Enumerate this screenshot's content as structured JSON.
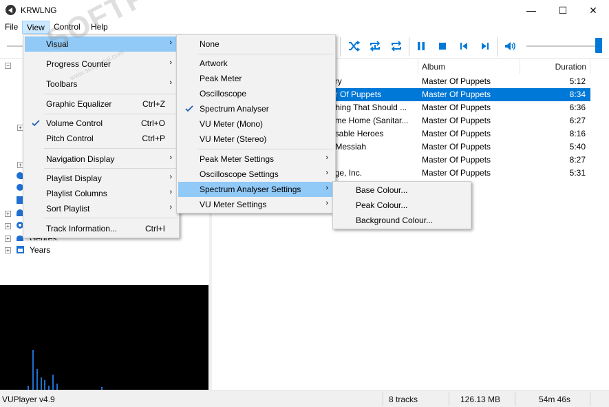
{
  "window": {
    "title": "KRWLNG",
    "minimize_glyph": "—",
    "maximize_glyph": "☐",
    "close_glyph": "✕"
  },
  "menubar": {
    "file": "File",
    "view": "View",
    "control": "Control",
    "help": "Help"
  },
  "tree": {
    "genres_partial": "Genres",
    "years": "Years"
  },
  "playlist": {
    "columns": {
      "album": "Album",
      "duration": "Duration"
    },
    "rows": [
      {
        "title": "ery",
        "album": "Master Of Puppets",
        "duration": "5:12",
        "selected": false
      },
      {
        "title": "er Of Puppets",
        "album": "Master Of Puppets",
        "duration": "8:34",
        "selected": true
      },
      {
        "title": "Thing That Should ...",
        "album": "Master Of Puppets",
        "duration": "6:36",
        "selected": false
      },
      {
        "title": "ome Home (Sanitar...",
        "album": "Master Of Puppets",
        "duration": "6:27",
        "selected": false
      },
      {
        "title": "osable Heroes",
        "album": "Master Of Puppets",
        "duration": "8:16",
        "selected": false
      },
      {
        "title": "r Messiah",
        "album": "Master Of Puppets",
        "duration": "5:40",
        "selected": false
      },
      {
        "title": "n",
        "album": "Master Of Puppets",
        "duration": "8:27",
        "selected": false
      },
      {
        "title": "age, Inc.",
        "album": "Master Of Puppets",
        "duration": "5:31",
        "selected": false
      }
    ]
  },
  "statusbar": {
    "version": "VUPlayer v4.9",
    "tracks": "8 tracks",
    "size": "126.13 MB",
    "length": "54m 46s"
  },
  "view_menu": {
    "items": [
      {
        "label": "Visual",
        "submenu": true
      },
      {
        "label": "Progress Counter",
        "submenu": true
      },
      {
        "label": "Toolbars",
        "submenu": true
      },
      {
        "label": "Graphic Equalizer",
        "shortcut": "Ctrl+Z"
      },
      {
        "label": "Volume Control",
        "shortcut": "Ctrl+O",
        "checked": true
      },
      {
        "label": "Pitch Control",
        "shortcut": "Ctrl+P"
      },
      {
        "label": "Navigation Display",
        "submenu": true
      },
      {
        "label": "Playlist Display",
        "submenu": true
      },
      {
        "label": "Playlist Columns",
        "submenu": true
      },
      {
        "label": "Sort Playlist",
        "submenu": true
      },
      {
        "label": "Track Information...",
        "shortcut": "Ctrl+I"
      }
    ]
  },
  "visual_menu": {
    "items": [
      {
        "label": "None"
      },
      {
        "label": "Artwork"
      },
      {
        "label": "Peak Meter"
      },
      {
        "label": "Oscilloscope"
      },
      {
        "label": "Spectrum Analyser",
        "checked": true
      },
      {
        "label": "VU Meter (Mono)"
      },
      {
        "label": "VU Meter (Stereo)"
      },
      {
        "label": "Peak Meter Settings",
        "submenu": true
      },
      {
        "label": "Oscilloscope Settings",
        "submenu": true
      },
      {
        "label": "Spectrum Analyser Settings",
        "submenu": true
      },
      {
        "label": "VU Meter Settings",
        "submenu": true
      }
    ]
  },
  "spectrum_menu": {
    "items": [
      {
        "label": "Base Colour..."
      },
      {
        "label": "Peak Colour..."
      },
      {
        "label": "Background Colour..."
      }
    ]
  },
  "watermark": {
    "text": "SOFTPORTAL",
    "sub": "www.softportal.com",
    "tm": "™"
  },
  "colors": {
    "accent": "#0078d7",
    "menu_highlight": "#91c9f7",
    "menu_bg": "#f2f2f2",
    "visualiser_bg": "#000000"
  },
  "icons": [
    "shuffle-icon",
    "repeat-track-icon",
    "repeat-all-icon",
    "pause-icon",
    "stop-icon",
    "previous-icon",
    "next-icon",
    "volume-icon"
  ]
}
